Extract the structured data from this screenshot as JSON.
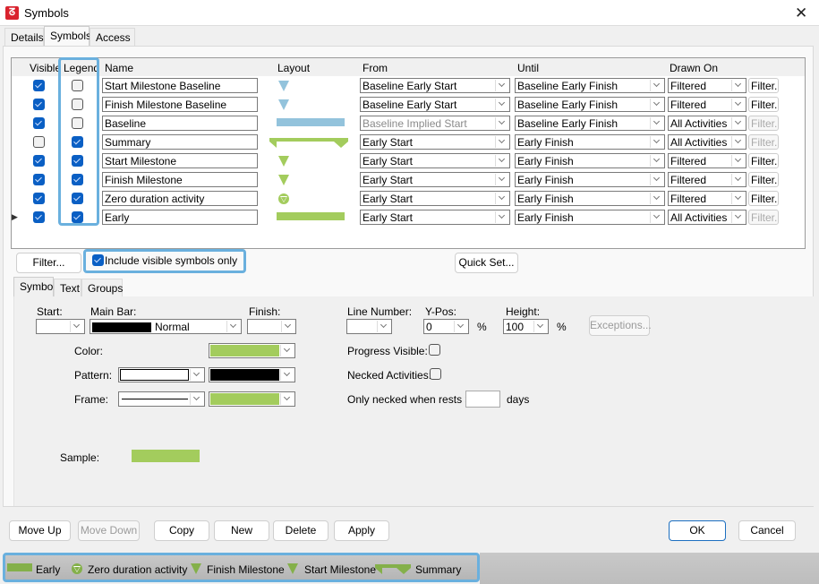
{
  "window": {
    "title": "Symbols",
    "app_icon": "app-logo-icon",
    "close_icon": "close-icon"
  },
  "tabs": [
    {
      "label": "Details"
    },
    {
      "label": "Symbols",
      "active": true
    },
    {
      "label": "Access"
    }
  ],
  "grid": {
    "headers": {
      "visible": "Visible",
      "legend": "Legend",
      "name": "Name",
      "layout": "Layout",
      "from": "From",
      "until": "Until",
      "drawn_on": "Drawn On"
    },
    "rows": [
      {
        "visible": true,
        "legend": false,
        "name": "Start Milestone Baseline",
        "layout": "triangle-blue",
        "from": "Baseline Early Start",
        "from_disabled": false,
        "until": "Baseline Early Finish",
        "drawn_on": "Filtered",
        "filter_label": "Filter...",
        "filter_enabled": true
      },
      {
        "visible": true,
        "legend": false,
        "name": "Finish Milestone Baseline",
        "layout": "triangle-blue",
        "from": "Baseline Early Start",
        "from_disabled": false,
        "until": "Baseline Early Finish",
        "drawn_on": "Filtered",
        "filter_label": "Filter...",
        "filter_enabled": true
      },
      {
        "visible": true,
        "legend": false,
        "name": "Baseline",
        "layout": "bar-blue",
        "from": "Baseline Implied Start",
        "from_disabled": true,
        "until": "Baseline Early Finish",
        "drawn_on": "All Activities",
        "filter_label": "Filter...",
        "filter_enabled": false
      },
      {
        "visible": false,
        "legend": true,
        "name": "Summary",
        "layout": "summary-green",
        "from": "Early Start",
        "from_disabled": false,
        "until": "Early Finish",
        "drawn_on": "All Activities",
        "filter_label": "Filter...",
        "filter_enabled": false
      },
      {
        "visible": true,
        "legend": true,
        "name": "Start Milestone",
        "layout": "triangle-green",
        "from": "Early Start",
        "from_disabled": false,
        "until": "Early Finish",
        "drawn_on": "Filtered",
        "filter_label": "Filter...",
        "filter_enabled": true
      },
      {
        "visible": true,
        "legend": true,
        "name": "Finish Milestone",
        "layout": "triangle-green",
        "from": "Early Start",
        "from_disabled": false,
        "until": "Early Finish",
        "drawn_on": "Filtered",
        "filter_label": "Filter...",
        "filter_enabled": true
      },
      {
        "visible": true,
        "legend": true,
        "name": "Zero duration activity",
        "layout": "circle-triangle-green",
        "from": "Early Start",
        "from_disabled": false,
        "until": "Early Finish",
        "drawn_on": "Filtered",
        "filter_label": "Filter...",
        "filter_enabled": true
      },
      {
        "visible": true,
        "legend": true,
        "name": "Early",
        "layout": "bar-green",
        "from": "Early Start",
        "from_disabled": false,
        "until": "Early Finish",
        "drawn_on": "All Activities",
        "filter_label": "Filter...",
        "filter_enabled": false,
        "current": true
      }
    ]
  },
  "below_grid": {
    "filter_button": "Filter...",
    "include_visible_label": "Include visible symbols only",
    "include_visible_checked": true,
    "quick_set_button": "Quick Set..."
  },
  "subtabs": [
    {
      "label": "Symbol",
      "active": true
    },
    {
      "label": "Text"
    },
    {
      "label": "Groups"
    }
  ],
  "symbol": {
    "start_label": "Start:",
    "start_value": "",
    "main_bar_label": "Main Bar:",
    "main_bar_value": "Normal",
    "finish_label": "Finish:",
    "finish_value": "",
    "line_number_label": "Line Number:",
    "line_number_value": "",
    "ypos_label": "Y-Pos:",
    "ypos_value": "0",
    "ypos_unit": "%",
    "height_label": "Height:",
    "height_value": "100",
    "height_unit": "%",
    "exceptions_button": "Exceptions...",
    "color_label": "Color:",
    "color_value": "#a3cc5d",
    "pattern_label": "Pattern:",
    "pattern_fg": "#ffffff",
    "pattern_bg": "#000000",
    "frame_label": "Frame:",
    "frame_color": "#a3cc5d",
    "progress_visible_label": "Progress Visible:",
    "progress_visible": false,
    "necked_label": "Necked Activities:",
    "necked": false,
    "necked_rests_label": "Only necked when rests >",
    "necked_rests_value": "",
    "days_label": "days",
    "sample_label": "Sample:"
  },
  "buttons": {
    "move_up": "Move Up",
    "move_down": "Move Down",
    "copy": "Copy",
    "new": "New",
    "delete": "Delete",
    "apply": "Apply",
    "ok": "OK",
    "cancel": "Cancel"
  },
  "legend": [
    {
      "label": "Early",
      "icon": "bar-green"
    },
    {
      "label": "Zero duration activity",
      "icon": "circle-triangle-green"
    },
    {
      "label": "Finish Milestone",
      "icon": "triangle-green"
    },
    {
      "label": "Start Milestone",
      "icon": "triangle-green"
    },
    {
      "label": "Summary",
      "icon": "summary-green"
    }
  ],
  "colors": {
    "green": "#a3cc5d",
    "legend_green": "#84b04a",
    "blue": "#93c3dc",
    "highlight": "#6ab0de",
    "check": "#0a5fc4"
  }
}
